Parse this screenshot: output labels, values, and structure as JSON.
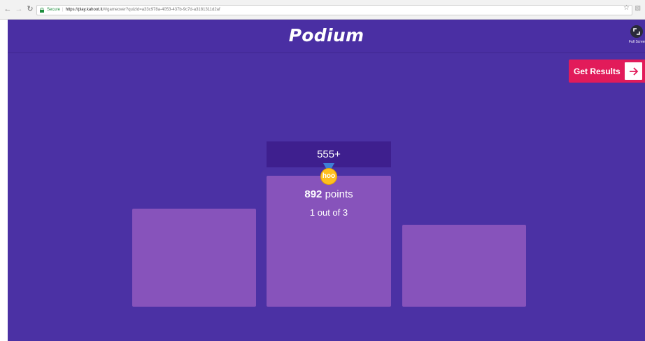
{
  "browser": {
    "secure_label": "Secure",
    "url_host": "https://play.kahoot.it",
    "url_path": "/#/gameover?quizId=a33c978a-4053-437b-9c7d-a3181311d2af"
  },
  "app": {
    "title": "Podium",
    "fullscreen_label": "Full Screen",
    "get_results_label": "Get Results",
    "accent_color": "#e21b5a",
    "background_color": "#4b31a4"
  },
  "podium": {
    "winner_name": "555+",
    "medal_text": "hoo",
    "winner_points_value": "892",
    "winner_points_unit": "points",
    "winner_rank": "1 out of 3"
  }
}
